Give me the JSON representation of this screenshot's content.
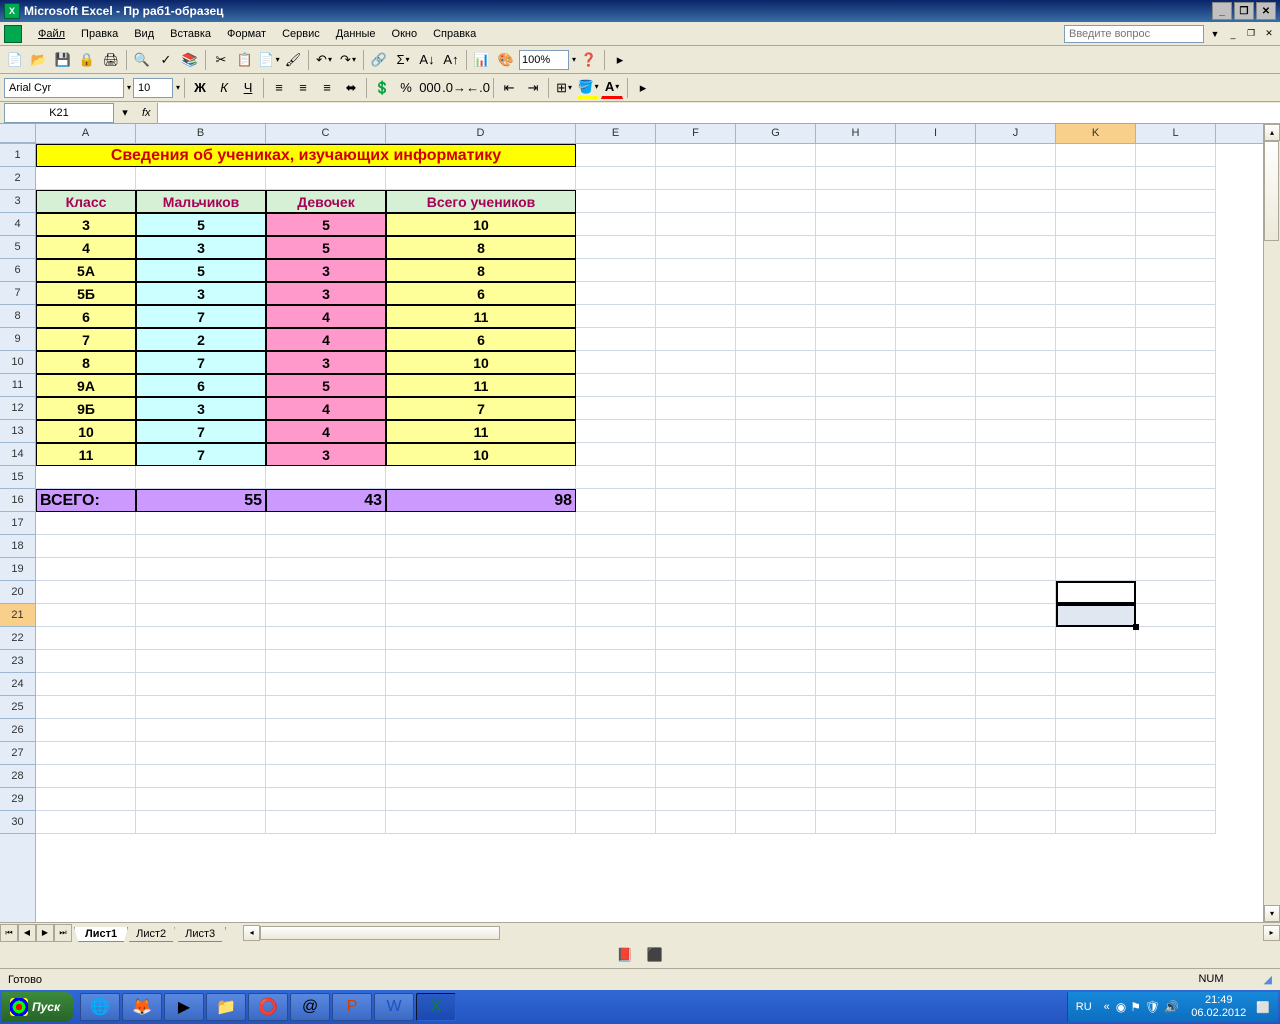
{
  "titlebar": {
    "app": "Microsoft Excel",
    "doc": "Пр раб1-образец"
  },
  "menu": {
    "items": [
      "Файл",
      "Правка",
      "Вид",
      "Вставка",
      "Формат",
      "Сервис",
      "Данные",
      "Окно",
      "Справка"
    ],
    "question_placeholder": "Введите вопрос"
  },
  "toolbar": {
    "zoom": "100%"
  },
  "format": {
    "font": "Arial Cyr",
    "size": "10"
  },
  "formulabar": {
    "cell_ref": "K21",
    "fx": "fx",
    "formula": ""
  },
  "columns": [
    "A",
    "B",
    "C",
    "D",
    "E",
    "F",
    "G",
    "H",
    "I",
    "J",
    "K",
    "L"
  ],
  "sheet": {
    "title": "Сведения об учениках, изучающих информатику",
    "headers": {
      "class": "Класс",
      "boys": "Мальчиков",
      "girls": "Девочек",
      "total": "Всего учеников"
    },
    "rows": [
      {
        "class": "3",
        "boys": "5",
        "girls": "5",
        "total": "10"
      },
      {
        "class": "4",
        "boys": "3",
        "girls": "5",
        "total": "8"
      },
      {
        "class": "5А",
        "boys": "5",
        "girls": "3",
        "total": "8"
      },
      {
        "class": "5Б",
        "boys": "3",
        "girls": "3",
        "total": "6"
      },
      {
        "class": "6",
        "boys": "7",
        "girls": "4",
        "total": "11"
      },
      {
        "class": "7",
        "boys": "2",
        "girls": "4",
        "total": "6"
      },
      {
        "class": "8",
        "boys": "7",
        "girls": "3",
        "total": "10"
      },
      {
        "class": "9А",
        "boys": "6",
        "girls": "5",
        "total": "11"
      },
      {
        "class": "9Б",
        "boys": "3",
        "girls": "4",
        "total": "7"
      },
      {
        "class": "10",
        "boys": "7",
        "girls": "4",
        "total": "11"
      },
      {
        "class": "11",
        "boys": "7",
        "girls": "3",
        "total": "10"
      }
    ],
    "total": {
      "label": "ВСЕГО:",
      "boys": "55",
      "girls": "43",
      "total": "98"
    }
  },
  "tabs": {
    "active": "Лист1",
    "all": [
      "Лист1",
      "Лист2",
      "Лист3"
    ]
  },
  "statusbar": {
    "ready": "Готово",
    "num": "NUM"
  },
  "taskbar": {
    "start": "Пуск",
    "lang": "RU",
    "time": "21:49",
    "date": "06.02.2012"
  },
  "chart_data": {
    "type": "table",
    "title": "Сведения об учениках, изучающих информатику",
    "columns": [
      "Класс",
      "Мальчиков",
      "Девочек",
      "Всего учеников"
    ],
    "rows": [
      [
        "3",
        5,
        5,
        10
      ],
      [
        "4",
        3,
        5,
        8
      ],
      [
        "5А",
        5,
        3,
        8
      ],
      [
        "5Б",
        3,
        3,
        6
      ],
      [
        "6",
        7,
        4,
        11
      ],
      [
        "7",
        2,
        4,
        6
      ],
      [
        "8",
        7,
        3,
        10
      ],
      [
        "9А",
        6,
        5,
        11
      ],
      [
        "9Б",
        3,
        4,
        7
      ],
      [
        "10",
        7,
        4,
        11
      ],
      [
        "11",
        7,
        3,
        10
      ]
    ],
    "totals": {
      "boys": 55,
      "girls": 43,
      "total": 98
    }
  }
}
